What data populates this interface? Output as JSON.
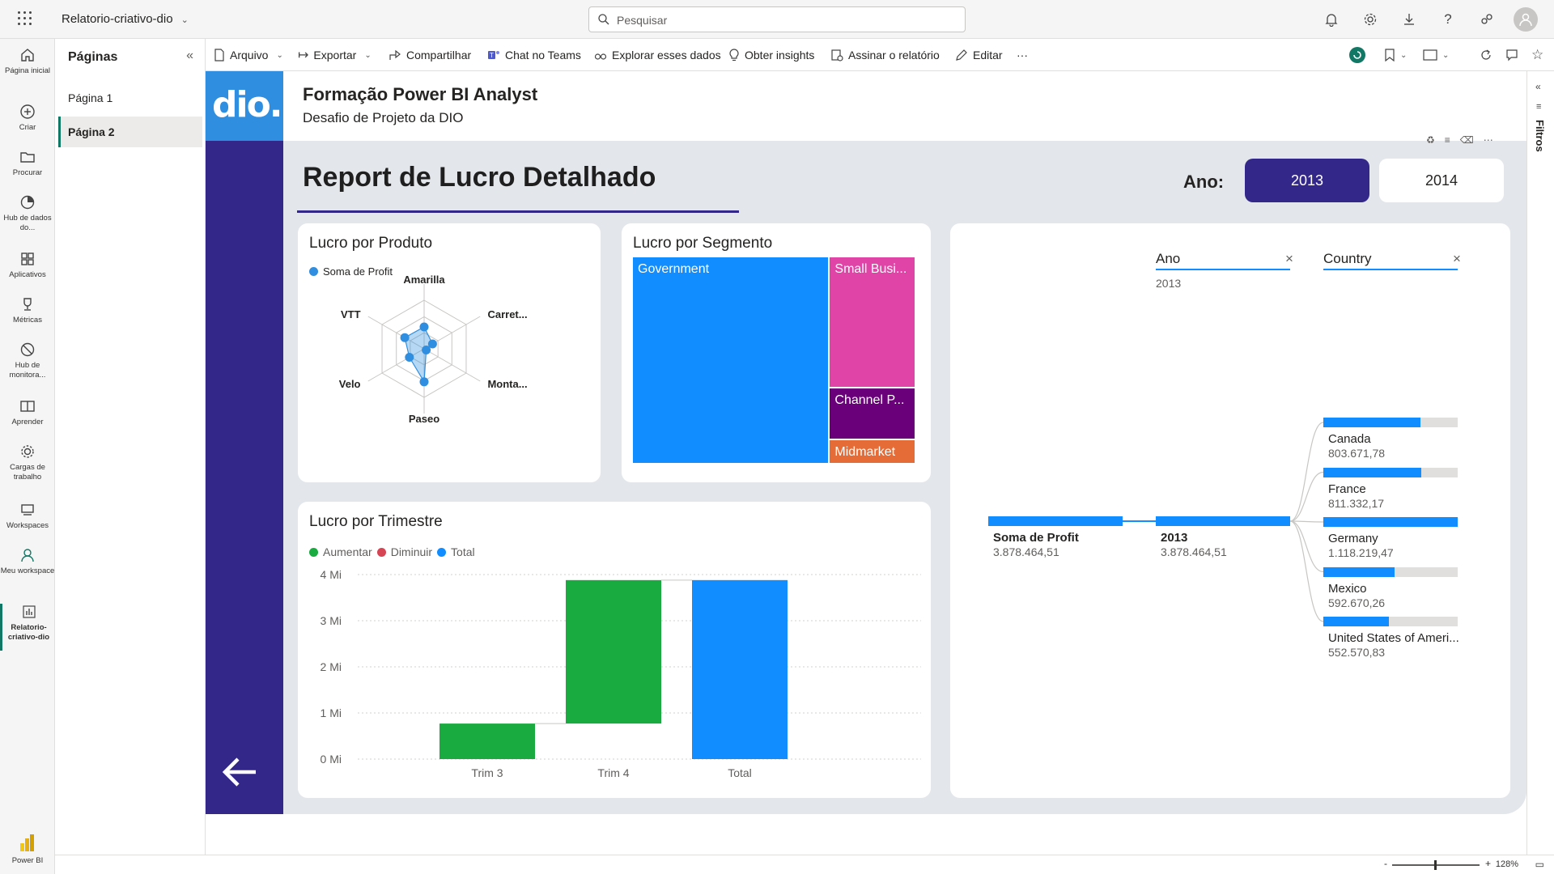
{
  "app": {
    "title": "Relatorio-criativo-dio",
    "search_placeholder": "Pesquisar"
  },
  "leftnav": {
    "items": [
      {
        "label": "Página inicial",
        "icon": "home-icon"
      },
      {
        "label": "Criar",
        "icon": "plus-icon"
      },
      {
        "label": "Procurar",
        "icon": "folder-icon"
      },
      {
        "label": "Hub de dados do...",
        "icon": "data-hub-icon"
      },
      {
        "label": "Aplicativos",
        "icon": "apps-icon"
      },
      {
        "label": "Métricas",
        "icon": "trophy-icon"
      },
      {
        "label": "Hub de monitora...",
        "icon": "monitor-icon"
      },
      {
        "label": "Aprender",
        "icon": "book-icon"
      },
      {
        "label": "Cargas de trabalho",
        "icon": "workloads-icon"
      },
      {
        "label": "Workspaces",
        "icon": "workspaces-icon"
      },
      {
        "label": "Meu workspace",
        "icon": "person-icon"
      },
      {
        "label": "Relatorio-criativo-dio",
        "icon": "report-icon"
      }
    ],
    "brand": "Power BI"
  },
  "pages_pane": {
    "title": "Páginas",
    "pages": [
      "Página 1",
      "Página 2"
    ],
    "selected": "Página 2"
  },
  "toolbar": {
    "file": "Arquivo",
    "export": "Exportar",
    "share": "Compartilhar",
    "teams": "Chat no Teams",
    "explore": "Explorar esses dados",
    "insights": "Obter insights",
    "subscribe": "Assinar o relatório",
    "edit": "Editar",
    "more": "···"
  },
  "report": {
    "header_title": "Formação Power BI Analyst",
    "header_subtitle": "Desafio de Projeto da DIO",
    "logo_text": "dio.",
    "title": "Report de Lucro Detalhado",
    "year_label": "Ano:",
    "years": [
      "2013",
      "2014"
    ],
    "selected_year": "2013",
    "accent": "#33278a",
    "logo_bg": "#2f8ee0"
  },
  "filters_pane": {
    "label": "Filtros"
  },
  "status": {
    "zoom": "128%",
    "minus": "-",
    "plus": "+"
  },
  "chart_data": [
    {
      "type": "radar",
      "title": "Lucro por Produto",
      "legend": [
        "Soma de Profit"
      ],
      "categories": [
        "Amarilla",
        "Carret...",
        "Monta...",
        "Paseo",
        "Velo",
        "VTT"
      ],
      "series": [
        {
          "name": "Soma de Profit",
          "values": [
            0.45,
            0.2,
            0.05,
            0.68,
            0.35,
            0.46
          ]
        }
      ],
      "color": "#2f8ee0"
    },
    {
      "type": "treemap",
      "title": "Lucro por Segmento",
      "categories": [
        "Government",
        "Small Busi...",
        "Channel P...",
        "Midmarket"
      ],
      "values": [
        2215,
        615,
        243,
        112
      ],
      "colors": [
        "#118dff",
        "#e044a7",
        "#6b007b",
        "#e66c37"
      ]
    },
    {
      "type": "waterfall",
      "title": "Lucro por Trimestre",
      "legend": [
        "Aumentar",
        "Diminuir",
        "Total"
      ],
      "legend_colors": [
        "#1aab40",
        "#d64554",
        "#118dff"
      ],
      "categories": [
        "Trim 3",
        "Trim 4",
        "Total"
      ],
      "values": [
        0.77,
        3.11,
        3.88
      ],
      "ylim": [
        0,
        4
      ],
      "yticks": [
        "0 Mi",
        "1 Mi",
        "2 Mi",
        "3 Mi",
        "4 Mi"
      ]
    },
    {
      "type": "decomposition_tree",
      "levels": [
        {
          "header": "Ano",
          "sub": "2013"
        },
        {
          "header": "Country",
          "sub": ""
        }
      ],
      "root": {
        "label": "Soma de Profit",
        "value": "3.878.464,51",
        "fraction": 1.0
      },
      "year_node": {
        "label": "2013",
        "value": "3.878.464,51",
        "fraction": 1.0
      },
      "countries": [
        {
          "label": "Canada",
          "value": "803.671,78",
          "fraction": 0.72
        },
        {
          "label": "France",
          "value": "811.332,17",
          "fraction": 0.73
        },
        {
          "label": "Germany",
          "value": "1.118.219,47",
          "fraction": 1.0
        },
        {
          "label": "Mexico",
          "value": "592.670,26",
          "fraction": 0.53
        },
        {
          "label": "United States of Ameri...",
          "value": "552.570,83",
          "fraction": 0.49
        }
      ]
    }
  ]
}
